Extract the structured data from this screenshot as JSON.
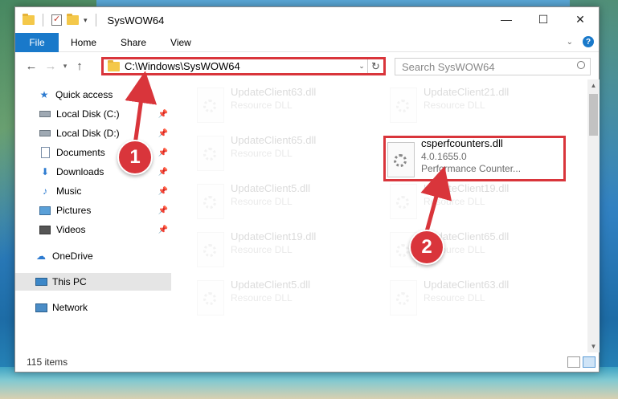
{
  "window": {
    "title": "SysWOW64",
    "controls": [
      "—",
      "☐",
      "✕"
    ]
  },
  "ribbon": {
    "file_tab": "File",
    "tabs": [
      "Home",
      "Share",
      "View"
    ]
  },
  "address_bar": {
    "path": "C:\\Windows\\SysWOW64",
    "search_placeholder": "Search SysWOW64"
  },
  "nav_pane": {
    "quick_access": "Quick access",
    "items": [
      {
        "label": "Local Disk (C:)",
        "icon": "drive-icon",
        "pinned": true
      },
      {
        "label": "Local Disk (D:)",
        "icon": "drive-icon",
        "pinned": true
      },
      {
        "label": "Documents",
        "icon": "documents-icon",
        "pinned": true
      },
      {
        "label": "Downloads",
        "icon": "downloads-icon",
        "pinned": true
      },
      {
        "label": "Music",
        "icon": "music-icon",
        "pinned": true
      },
      {
        "label": "Pictures",
        "icon": "pictures-icon",
        "pinned": true
      },
      {
        "label": "Videos",
        "icon": "videos-icon",
        "pinned": true
      }
    ],
    "onedrive": "OneDrive",
    "this_pc": "This PC",
    "network": "Network"
  },
  "files": {
    "left_column": [
      {
        "name": "UpdateClient63.dll",
        "sub": "Resource DLL"
      },
      {
        "name": "UpdateClient65.dll",
        "sub": "Resource DLL"
      },
      {
        "name": "UpdateClient5.dll",
        "sub": "Resource DLL"
      },
      {
        "name": "UpdateClient19.dll",
        "sub": "Resource DLL"
      },
      {
        "name": "UpdateClient5.dll",
        "sub": "Resource DLL"
      }
    ],
    "right_column": [
      {
        "name": "UpdateClient21.dll",
        "sub": "Resource DLL"
      },
      {
        "name": "UpdateClient19.dll",
        "sub": "Resource DLL"
      },
      {
        "name": "UpdateClient65.dll",
        "sub": "Resource DLL"
      },
      {
        "name": "UpdateClient63.dll",
        "sub": "Resource DLL"
      }
    ],
    "selected": {
      "name": "csperfcounters.dll",
      "version": "4.0.1655.0",
      "description": "Performance Counter..."
    }
  },
  "status_bar": {
    "item_count": "115 items"
  },
  "annotations": {
    "step1": "1",
    "step2": "2",
    "color": "#d9353b"
  },
  "colors": {
    "file_tab": "#1979ca",
    "highlight": "#d9353b"
  }
}
